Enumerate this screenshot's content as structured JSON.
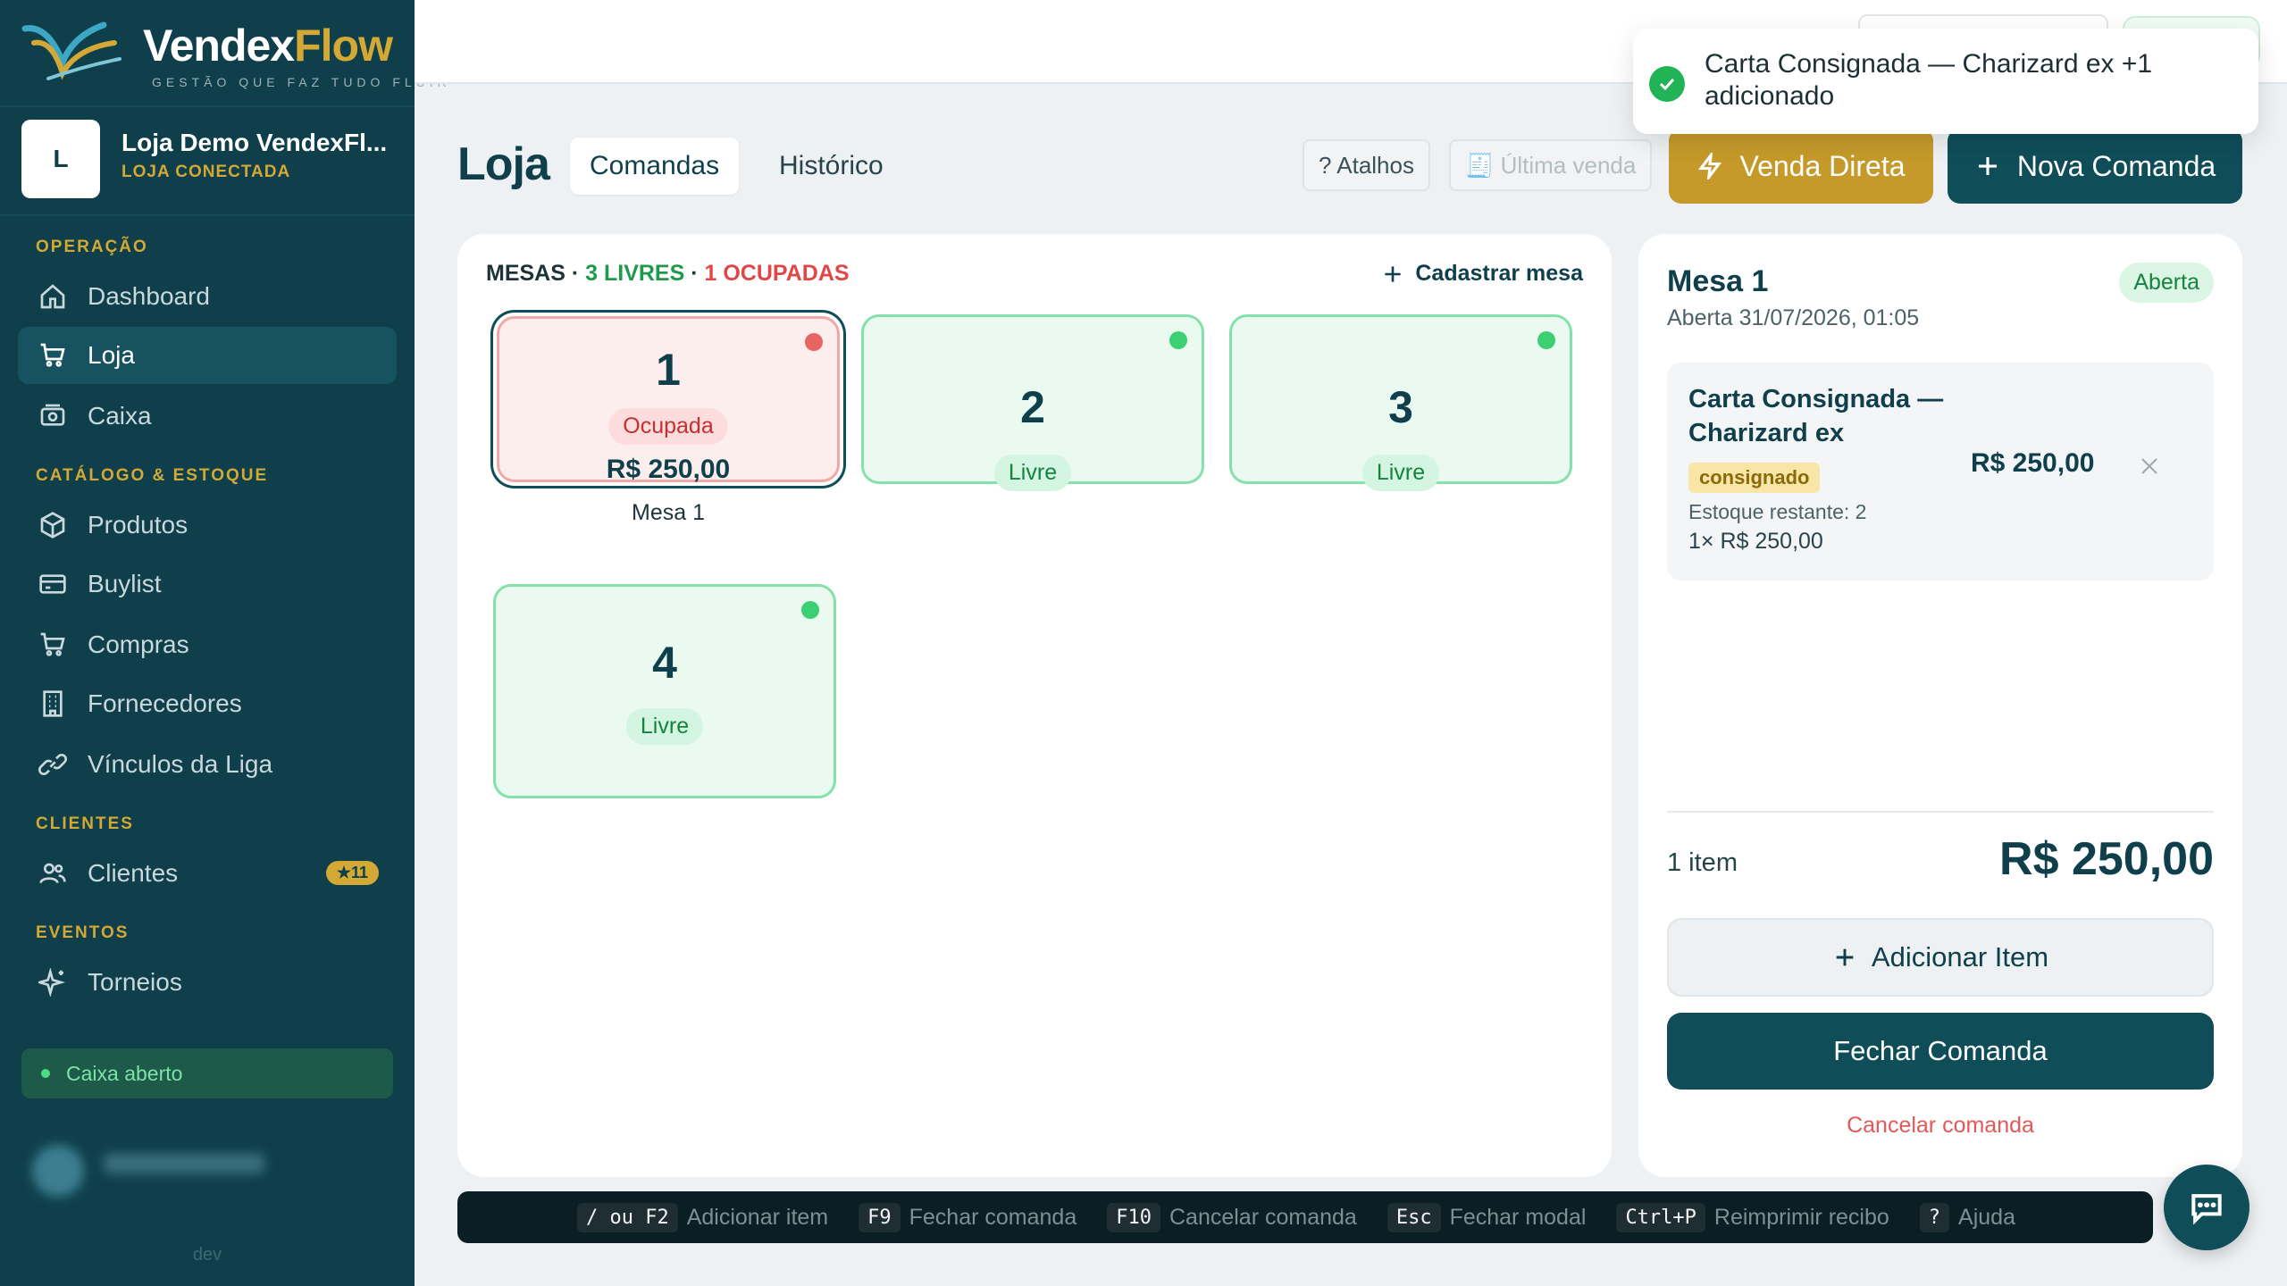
{
  "brand": {
    "name_part1": "Vendex",
    "name_part2": "Flow",
    "tagline": "GESTÃO QUE FAZ TUDO FLUIR"
  },
  "store": {
    "avatar_letter": "L",
    "name": "Loja Demo VendexFl...",
    "status": "LOJA CONECTADA"
  },
  "sidebar": {
    "sections": {
      "operacao": "OPERAÇÃO",
      "catalogo": "CATÁLOGO & ESTOQUE",
      "clientes": "CLIENTES",
      "eventos": "EVENTOS"
    },
    "items": {
      "dashboard": "Dashboard",
      "loja": "Loja",
      "caixa": "Caixa",
      "produtos": "Produtos",
      "buylist": "Buylist",
      "compras": "Compras",
      "fornecedores": "Fornecedores",
      "vinculos": "Vínculos da Liga",
      "clientes": "Clientes",
      "clientes_badge": "★11",
      "torneios": "Torneios"
    },
    "caixa_status": "Caixa aberto",
    "footer": "dev"
  },
  "toast": {
    "message": "Carta Consignada — Charizard ex +1 adicionado"
  },
  "header": {
    "title": "Loja",
    "tabs": [
      "Comandas",
      "Histórico"
    ],
    "atalhos": "? Atalhos",
    "ultima_venda": "🧾 Última venda",
    "venda_direta": "Venda Direta",
    "nova_comanda": "Nova Comanda"
  },
  "mesas": {
    "head_prefix": "MESAS · ",
    "livres": "3 LIVRES",
    "dot_sep": " · ",
    "ocupadas": "1 OCUPADAS",
    "cadastrar": "Cadastrar mesa",
    "list": [
      {
        "number": "1",
        "status": "Ocupada",
        "value": "R$ 250,00",
        "label": "Mesa 1"
      },
      {
        "number": "2",
        "status": "Livre"
      },
      {
        "number": "3",
        "status": "Livre"
      },
      {
        "number": "4",
        "status": "Livre"
      }
    ]
  },
  "comanda": {
    "title": "Mesa 1",
    "opened": "Aberta 31/07/2026, 01:05",
    "badge": "Aberta",
    "item": {
      "name": "Carta Consignada — Charizard ex",
      "tag": "consignado",
      "stock": "Estoque restante: 2",
      "qty": "1× R$ 250,00",
      "price": "R$ 250,00"
    },
    "count": "1 item",
    "total": "R$ 250,00",
    "add_item": "Adicionar Item",
    "fechar": "Fechar Comanda",
    "cancelar": "Cancelar comanda"
  },
  "shortcuts": [
    {
      "key": "/ ou F2",
      "label": "Adicionar item"
    },
    {
      "key": "F9",
      "label": "Fechar comanda"
    },
    {
      "key": "F10",
      "label": "Cancelar comanda"
    },
    {
      "key": "Esc",
      "label": "Fechar modal"
    },
    {
      "key": "Ctrl+P",
      "label": "Reimprimir recibo"
    },
    {
      "key": "?",
      "label": "Ajuda"
    }
  ],
  "colors": {
    "sidebar_bg": "#0f3f4b",
    "accent_gold": "#c59a2a",
    "primary_teal": "#0f4d59",
    "free_green": "#1f9a4c",
    "busy_red": "#e04848"
  }
}
